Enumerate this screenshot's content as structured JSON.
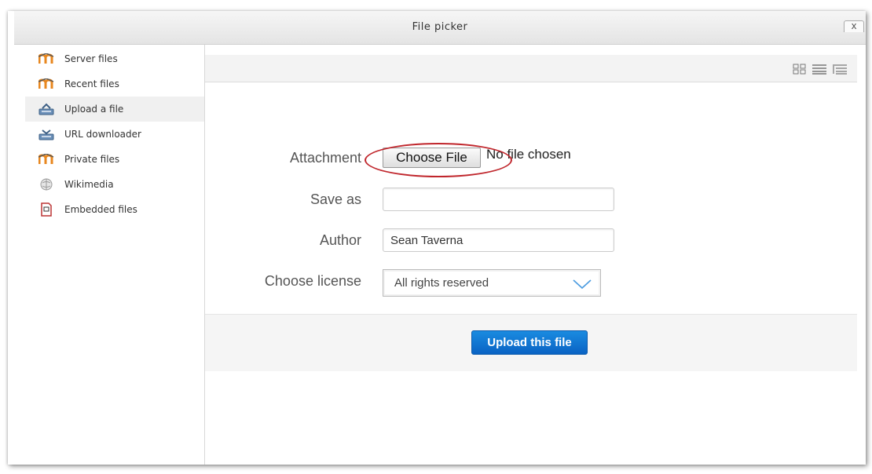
{
  "dialog": {
    "title": "File picker",
    "close_glyph": "x"
  },
  "sidebar": {
    "items": [
      {
        "label": "Server files",
        "icon": "moodle-icon",
        "active": false
      },
      {
        "label": "Recent files",
        "icon": "moodle-icon",
        "active": false
      },
      {
        "label": "Upload a file",
        "icon": "upload-icon",
        "active": true
      },
      {
        "label": "URL downloader",
        "icon": "download-icon",
        "active": false
      },
      {
        "label": "Private files",
        "icon": "moodle-icon",
        "active": false
      },
      {
        "label": "Wikimedia",
        "icon": "wikimedia-icon",
        "active": false
      },
      {
        "label": "Embedded files",
        "icon": "embedded-file-icon",
        "active": false
      }
    ]
  },
  "toolbar": {
    "view_icons": [
      "icon-view-icon",
      "list-view-icon",
      "tree-view-icon"
    ]
  },
  "form": {
    "attachment_label": "Attachment",
    "choose_file_label": "Choose File",
    "no_file_text": "No file chosen",
    "save_as_label": "Save as",
    "save_as_value": "",
    "author_label": "Author",
    "author_value": "Sean Taverna",
    "license_label": "Choose license",
    "license_value": "All rights reserved"
  },
  "actions": {
    "upload_label": "Upload this file"
  },
  "colors": {
    "accent": "#0a63c4",
    "annotation": "#c0262c",
    "moodle_orange": "#e8871e"
  }
}
